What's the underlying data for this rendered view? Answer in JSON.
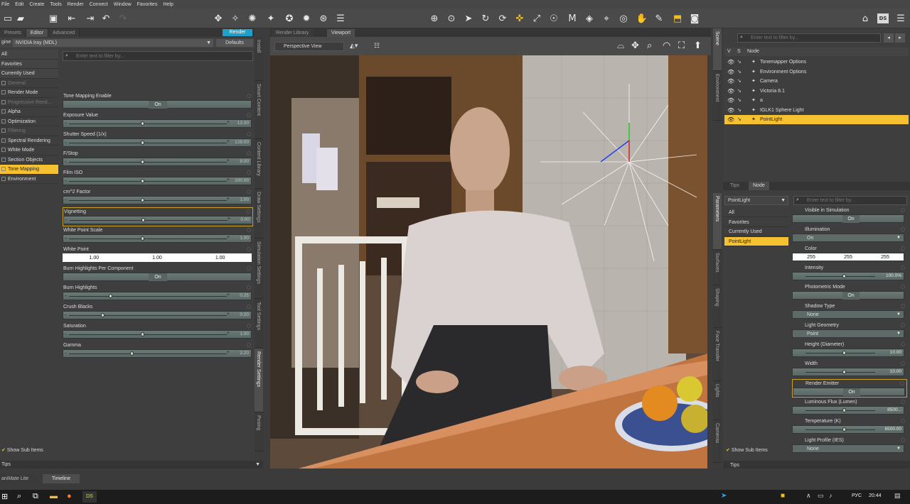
{
  "menu": [
    "File",
    "Edit",
    "Create",
    "Tools",
    "Render",
    "Connect",
    "Window",
    "Favorites",
    "Help"
  ],
  "left": {
    "tabs": [
      "Presets",
      "Editor",
      "Advanced"
    ],
    "render_btn": "Render",
    "engine_label": "gine :",
    "engine": "NVIDIA Iray (MDL)",
    "defaults": "Defaults",
    "filter_placeholder": "Enter text to filter by...",
    "categories": [
      {
        "label": "All",
        "state": "hdr"
      },
      {
        "label": "Favorites",
        "state": "hdr"
      },
      {
        "label": "Currently Used",
        "state": "hdr"
      },
      {
        "label": "General",
        "state": "dis"
      },
      {
        "label": "Render Mode",
        "state": ""
      },
      {
        "label": "Progressive Rend...",
        "state": "dis"
      },
      {
        "label": "Alpha",
        "state": ""
      },
      {
        "label": "Optimization",
        "state": ""
      },
      {
        "label": "Filtering",
        "state": "dis"
      },
      {
        "label": "Spectral Rendering",
        "state": ""
      },
      {
        "label": "White Mode",
        "state": ""
      },
      {
        "label": "Section Objects",
        "state": ""
      },
      {
        "label": "Tone Mapping",
        "state": "sel"
      },
      {
        "label": "Environment",
        "state": ""
      }
    ],
    "show_sub": "Show Sub Items",
    "tips": "Tips",
    "props": [
      {
        "label": "Tone Mapping Enable",
        "type": "button",
        "value": "On"
      },
      {
        "label": "Exposure Value",
        "type": "slider",
        "value": "13.00",
        "pos": 0.45
      },
      {
        "label": "Shutter Speed (1/x)",
        "type": "slider",
        "value": "128.00",
        "pos": 0.45
      },
      {
        "label": "F/Stop",
        "type": "slider",
        "value": "8.00",
        "pos": 0.45
      },
      {
        "label": "Film ISO",
        "type": "slider",
        "value": "100.00",
        "pos": 0.45
      },
      {
        "label": "cm^2 Factor",
        "type": "slider",
        "value": "1.00",
        "pos": 0.45
      },
      {
        "label": "Vignetting",
        "type": "slider",
        "value": "0.00",
        "pos": 0.45
      },
      {
        "label": "White Point Scale",
        "type": "slider",
        "value": "1.00",
        "pos": 0.45
      },
      {
        "label": "White Point",
        "type": "white",
        "values": [
          "1.00",
          "1.00",
          "1.00"
        ]
      },
      {
        "label": "Burn Highlights Per Component",
        "type": "button",
        "value": "On"
      },
      {
        "label": "Burn Highlights",
        "type": "slider",
        "value": "0.25",
        "pos": 0.25
      },
      {
        "label": "Crush Blacks",
        "type": "slider",
        "value": "0.20",
        "pos": 0.2
      },
      {
        "label": "Saturation",
        "type": "slider",
        "value": "1.00",
        "pos": 0.45
      },
      {
        "label": "Gamma",
        "type": "slider",
        "value": "2.20",
        "pos": 0.38
      }
    ]
  },
  "side_tabs": [
    "Install",
    "Smart Content",
    "Content Library",
    "Draw Settings",
    "Simulation Settings",
    "Tool Settings",
    "Render Settings",
    "Posing"
  ],
  "viewport": {
    "tabs": [
      "Render Library",
      "Viewport"
    ],
    "view": "Perspective View"
  },
  "scene": {
    "filter_placeholder": "Enter text to filter by...",
    "cols": [
      "V",
      "S",
      "Node"
    ],
    "nodes": [
      "Tonemapper Options",
      "Environment Options",
      "Camera",
      "Victoria 8.1",
      "a",
      "IGLK1 Sphere Light",
      "PointLight"
    ],
    "tabs": [
      "Tips",
      "Node"
    ]
  },
  "right_side_tabs": [
    "Scene",
    "Environment"
  ],
  "right_side_tabs2": [
    "Parameters",
    "Surfaces",
    "Shaping",
    "Face Transfer",
    "Lights",
    "Cameras"
  ],
  "params": {
    "node": "PointLight",
    "filter_placeholder": "Enter text to filter by...",
    "cats": [
      "All",
      "Favorites",
      "Currently Used",
      "PointLight"
    ],
    "show_sub": "Show Sub Items",
    "tips": "Tips",
    "props": [
      {
        "label": "Visible in Simulation",
        "type": "button",
        "value": "On"
      },
      {
        "label": "Illumination",
        "type": "dropdown",
        "value": "On"
      },
      {
        "label": "Color",
        "type": "color",
        "values": [
          "255",
          "255",
          "255"
        ]
      },
      {
        "label": "Intensity",
        "type": "slider",
        "value": "100.0%"
      },
      {
        "label": "Photometric Mode",
        "type": "button",
        "value": "On"
      },
      {
        "label": "Shadow Type",
        "type": "dropdown",
        "value": "None"
      },
      {
        "label": "Light Geometry",
        "type": "dropdown",
        "value": "Point"
      },
      {
        "label": "Height (Diameter)",
        "type": "slider",
        "value": "10.00"
      },
      {
        "label": "Width",
        "type": "slider",
        "value": "10.00"
      },
      {
        "label": "Render Emitter",
        "type": "button",
        "value": "On"
      },
      {
        "label": "Luminous Flux (Lumen)",
        "type": "slider",
        "value": "8500..."
      },
      {
        "label": "Temperature (K)",
        "type": "slider",
        "value": "6500.00"
      },
      {
        "label": "Light Profile (IES)",
        "type": "dropdown",
        "value": "None"
      }
    ]
  },
  "bottom_tabs": [
    "aniMate Lite",
    "Timeline"
  ],
  "taskbar": {
    "lang": "РУС",
    "time": "20:44",
    "app": "DS"
  }
}
